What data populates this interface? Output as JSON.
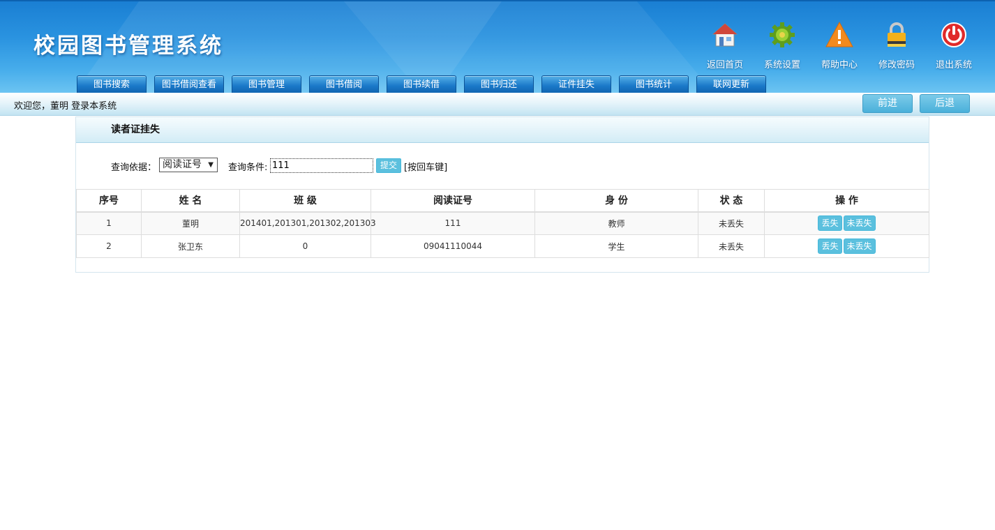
{
  "header": {
    "logo": "校园图书管理系统",
    "top_nav": [
      {
        "label": "返回首页",
        "icon": "home-icon"
      },
      {
        "label": "系统设置",
        "icon": "gear-icon"
      },
      {
        "label": "帮助中心",
        "icon": "warning-icon"
      },
      {
        "label": "修改密码",
        "icon": "lock-icon"
      },
      {
        "label": "退出系统",
        "icon": "power-icon"
      }
    ],
    "tabs": [
      "图书搜索",
      "图书借阅查看",
      "图书管理",
      "图书借阅",
      "图书续借",
      "图书归还",
      "证件挂失",
      "图书统计",
      "联网更新"
    ]
  },
  "welcome": {
    "text": "欢迎您，董明 登录本系统",
    "forward_label": "前进",
    "back_label": "后退"
  },
  "panel": {
    "title": "读者证挂失",
    "search": {
      "basis_label": "查询依据：",
      "basis_value": "阅读证号",
      "condition_label": "查询条件:",
      "condition_value": "111",
      "submit_label": "提交",
      "hint": "[按回车键]"
    },
    "table": {
      "headers": [
        "序号",
        "姓 名",
        "班 级",
        "阅读证号",
        "身 份",
        "状 态",
        "操 作"
      ],
      "rows": [
        {
          "index": "1",
          "name": "董明",
          "class": "201401,201301,201302,201303",
          "card": "111",
          "identity": "教师",
          "status": "未丢失",
          "lost_label": "丢失",
          "not_lost_label": "未丢失"
        },
        {
          "index": "2",
          "name": "张卫东",
          "class": "0",
          "card": "09041110044",
          "identity": "学生",
          "status": "未丢失",
          "lost_label": "丢失",
          "not_lost_label": "未丢失"
        }
      ]
    }
  },
  "colors": {
    "header_blue": "#2a93e0",
    "tab_blue": "#1a78c8",
    "button_cyan": "#5bc0de"
  }
}
